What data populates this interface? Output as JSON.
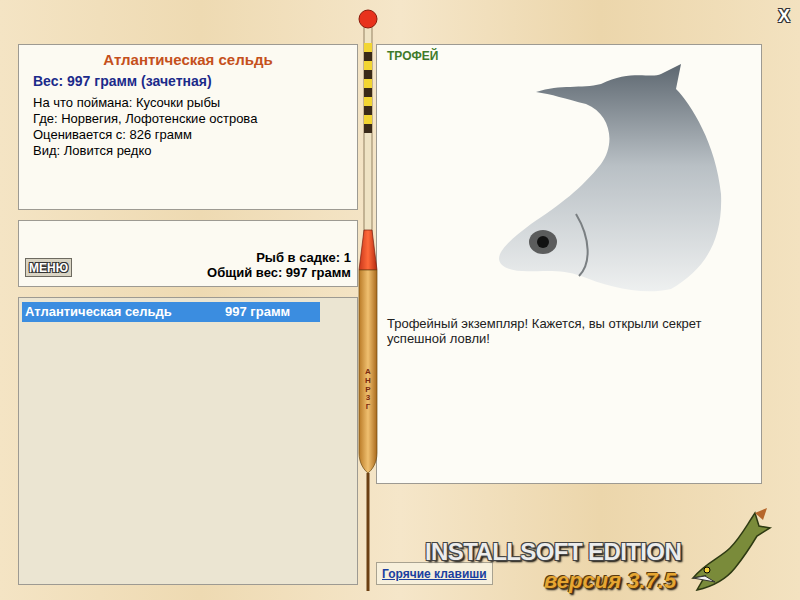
{
  "close": "X",
  "fish": {
    "name": "Атлантическая сельдь",
    "weight": "Вес: 997 грамм (зачетная)",
    "details": [
      "На что поймана: Кусочки рыбы",
      "Где: Норвегия, Лофотенские острова",
      "Оценивается с: 826 грамм",
      "Вид: Ловится редко"
    ]
  },
  "menu_button": "МЕНЮ",
  "keepnet": {
    "count": "Рыб в садке: 1",
    "total": "Общий вес: 997 грамм"
  },
  "catch_list": [
    {
      "name": "Атлантическая сельдь",
      "weight": "997 грамм",
      "selected": true
    }
  ],
  "float_label": "АНР 3Г",
  "trophy": {
    "badge": "ТРОФЕЙ",
    "message": "Трофейный экземпляр! Кажется, вы открыли секрет успешной ловли!"
  },
  "hotkeys_button": "Горячие клавиши",
  "brand": {
    "title": "INSTALLSOFT EDITION",
    "version": "версия 3.7.5"
  }
}
